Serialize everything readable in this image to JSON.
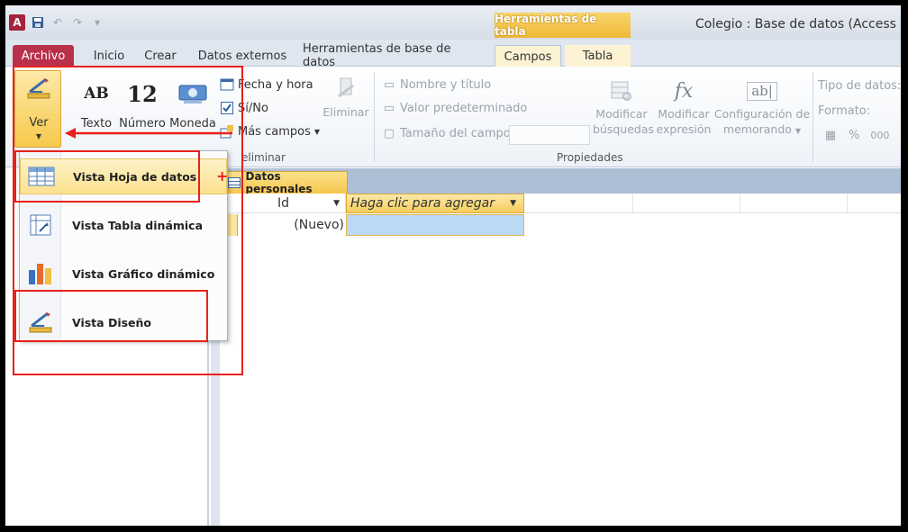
{
  "window": {
    "title": "Colegio : Base de datos (Access",
    "contextual_header": "Herramientas de tabla"
  },
  "tabs": {
    "archivo": "Archivo",
    "inicio": "Inicio",
    "crear": "Crear",
    "datos_externos": "Datos externos",
    "herramientas_bd": "Herramientas de base de datos",
    "campos": "Campos",
    "tabla": "Tabla"
  },
  "ribbon": {
    "ver": "Ver",
    "texto": "Texto",
    "numero": "Número",
    "numero_glyph": "12",
    "texto_glyph": "AB",
    "moneda": "Moneda",
    "fecha_hora": "Fecha y hora",
    "si_no": "Sí/No",
    "mas_campos": "Más campos",
    "eliminar": "Eliminar",
    "eliminar_group": "eliminar",
    "nombre_titulo": "Nombre y título",
    "valor_predeterminado": "Valor predeterminado",
    "tamano_campo": "Tamaño del campo",
    "modificar_busquedas": [
      "Modificar",
      "búsquedas"
    ],
    "modificar_expresion": [
      "Modificar",
      "expresión"
    ],
    "configuracion_memorando": [
      "Configuración de",
      "memorando"
    ],
    "propiedades": "Propiedades",
    "fx_glyph": "fx",
    "ab_glyph": "ab|",
    "tipo_datos": "Tipo de datos:",
    "formato": "Formato:",
    "percent": "%",
    "thousands": "000"
  },
  "document": {
    "tab_title": "Datos personales",
    "col_id": "Id",
    "col_add": "Haga clic para agregar",
    "new_row": "(Nuevo)"
  },
  "menu": {
    "items": [
      {
        "label": "Vista Hoja de datos"
      },
      {
        "label": "Vista Tabla dinámica"
      },
      {
        "label": "Vista Gráfico dinámico"
      },
      {
        "label": "Vista Diseño"
      }
    ]
  },
  "annotation": {
    "plus": "+"
  },
  "colors": {
    "accent_red": "#e8211b",
    "archivo": "#b9304a",
    "highlight": "#f7c94c"
  }
}
